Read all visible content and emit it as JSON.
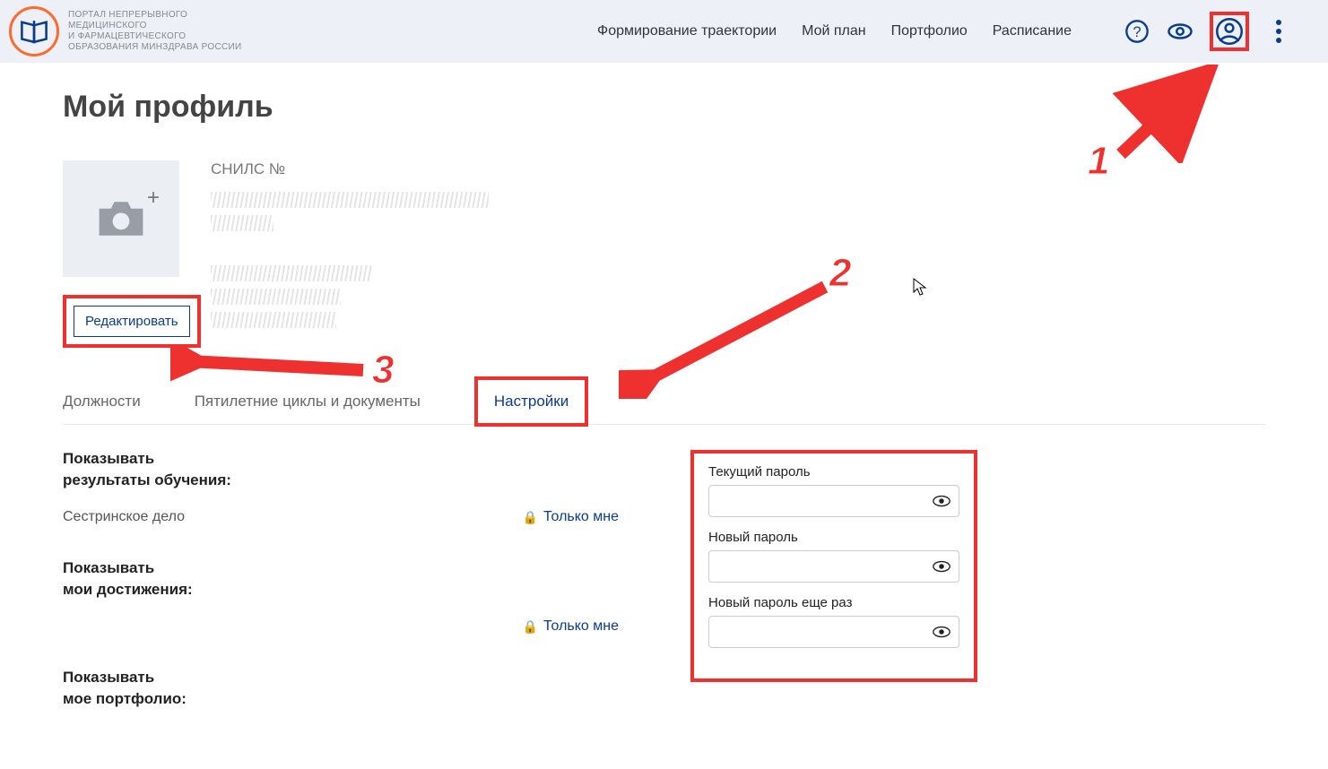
{
  "header": {
    "logo_text": "ПОРТАЛ НЕПРЕРЫВНОГО\nМЕДИЦИНСКОГО\nИ ФАРМАЦЕВТИЧЕСКОГО\nОБРАЗОВАНИЯ МИНЗДРАВА РОССИИ",
    "nav": {
      "trajectory": "Формирование траектории",
      "my_plan": "Мой план",
      "portfolio": "Портфолио",
      "schedule": "Расписание"
    }
  },
  "page": {
    "title": "Мой профиль"
  },
  "profile": {
    "snils_label": "СНИЛС №",
    "edit_button": "Редактировать"
  },
  "tabs": {
    "positions": "Должности",
    "cycles": "Пятилетние циклы и документы",
    "settings": "Настройки"
  },
  "settings": {
    "show_results_line1": "Показывать",
    "show_results_line2": "результаты обучения:",
    "nursing": "Сестринское дело",
    "only_me": "Только мне",
    "show_achievements_line1": "Показывать",
    "show_achievements_line2": "мои достижения:",
    "show_portfolio_line1": "Показывать",
    "show_portfolio_line2": "мое портфолио:"
  },
  "password": {
    "current_label": "Текущий пароль",
    "new_label": "Новый пароль",
    "repeat_label": "Новый пароль еще раз"
  },
  "annotations": {
    "n1": "1",
    "n2": "2",
    "n3": "3"
  }
}
